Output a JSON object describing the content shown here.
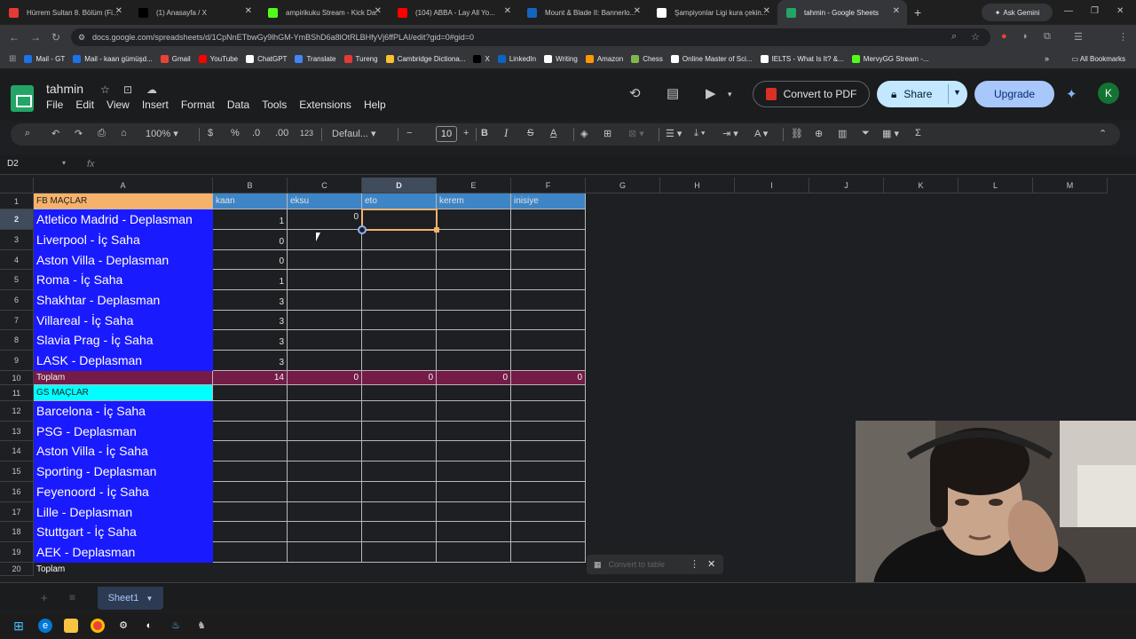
{
  "browser": {
    "tabs": [
      {
        "title": "Hürrem Sultan 8. Bölüm (Fi...",
        "color": "#e53935",
        "active": false
      },
      {
        "title": "(1) Anasayfa / X",
        "color": "#000000",
        "active": false
      },
      {
        "title": "ampirikuku Stream - Kick Da...",
        "color": "#53fc18",
        "active": false
      },
      {
        "title": "(104) ABBA - Lay All Yo...",
        "color": "#ff0000",
        "active": false
      },
      {
        "title": "Mount & Blade II: Bannerlo...",
        "color": "#1565c0",
        "active": false
      },
      {
        "title": "Şampiyonlar Ligi kura çekin...",
        "color": "#ffffff",
        "active": false
      },
      {
        "title": "tahmin - Google Sheets",
        "color": "#23a566",
        "active": true
      }
    ],
    "ask_gemini": "Ask Gemini",
    "url": "docs.google.com/spreadsheets/d/1CpNnETbwGy9lhGM-YmBShD6a8lOtRLBHfyVj6ffPLAI/edit?gid=0#gid=0",
    "bookmarks": [
      {
        "label": "Mail - GT",
        "color": "#1a73e8"
      },
      {
        "label": "Mail - kaan gümüşd...",
        "color": "#1a73e8"
      },
      {
        "label": "Gmail",
        "color": "#ea4335"
      },
      {
        "label": "YouTube",
        "color": "#ff0000"
      },
      {
        "label": "ChatGPT",
        "color": "#ffffff"
      },
      {
        "label": "Translate",
        "color": "#4285f4"
      },
      {
        "label": "Tureng",
        "color": "#e53935"
      },
      {
        "label": "Cambridge Dictiona...",
        "color": "#fbc02d"
      },
      {
        "label": "X",
        "color": "#000000"
      },
      {
        "label": "LinkedIn",
        "color": "#0a66c2"
      },
      {
        "label": "Writing",
        "color": "#ffffff"
      },
      {
        "label": "Amazon",
        "color": "#ff9900"
      },
      {
        "label": "Chess",
        "color": "#81b64c"
      },
      {
        "label": "Online Master of Sci...",
        "color": "#ffffff"
      },
      {
        "label": "IELTS - What Is It? &...",
        "color": "#ffffff"
      },
      {
        "label": "MervyGG Stream -...",
        "color": "#53fc18"
      }
    ],
    "all_bookmarks": "All Bookmarks"
  },
  "sheets": {
    "title": "tahmin",
    "menu": [
      "File",
      "Edit",
      "View",
      "Insert",
      "Format",
      "Data",
      "Tools",
      "Extensions",
      "Help"
    ],
    "convert_pdf": "Convert to PDF",
    "share": "Share",
    "upgrade": "Upgrade",
    "avatar_letter": "K",
    "zoom": "100%",
    "currency": "$",
    "percent": "%",
    "dec_decrease": ".0",
    "dec_increase": ".00",
    "number_format": "123",
    "font": "Defaul...",
    "font_size": "10",
    "name_box": "D2",
    "fx": "fx",
    "sheet_tab": "Sheet1",
    "convert_table": "Convert to table"
  },
  "grid": {
    "columns": [
      "A",
      "B",
      "C",
      "D",
      "E",
      "F",
      "G",
      "H",
      "I",
      "J",
      "K",
      "L",
      "M"
    ],
    "rows": [
      "1",
      "2",
      "3",
      "4",
      "5",
      "6",
      "7",
      "8",
      "9",
      "10",
      "11",
      "12",
      "13",
      "14",
      "15",
      "16",
      "17",
      "18",
      "19",
      "20"
    ],
    "header_row": {
      "a": "FB MAÇLAR",
      "b": "kaan",
      "c": "eksu",
      "d": "eto",
      "e": "kerem",
      "f": "inisiye"
    },
    "fb_matches": [
      {
        "team": "Atletico Madrid - Deplasman",
        "b": "1",
        "c": "0"
      },
      {
        "team": "Liverpool - İç Saha",
        "b": "0",
        "c": ""
      },
      {
        "team": "Aston Villa - Deplasman",
        "b": "0",
        "c": ""
      },
      {
        "team": "Roma - İç Saha",
        "b": "1",
        "c": ""
      },
      {
        "team": "Shakhtar - Deplasman",
        "b": "3",
        "c": ""
      },
      {
        "team": "Villareal - İç Saha",
        "b": "3",
        "c": ""
      },
      {
        "team": "Slavia Prag - İç Saha",
        "b": "3",
        "c": ""
      },
      {
        "team": "LASK - Deplasman",
        "b": "3",
        "c": ""
      }
    ],
    "fb_total": {
      "a": "Toplam",
      "b": "14",
      "c": "0",
      "d": "0",
      "e": "0",
      "f": "0"
    },
    "gs_header": "GS MAÇLAR",
    "gs_matches": [
      "Barcelona - İç Saha",
      "PSG - Deplasman",
      "Aston Villa - İç Saha",
      "Sporting - Deplasman",
      "Feyenoord - İç Saha",
      "Lille - Deplasman",
      "Stuttgart - İç Saha",
      "AEK - Deplasman"
    ],
    "gs_total": "Toplam"
  }
}
